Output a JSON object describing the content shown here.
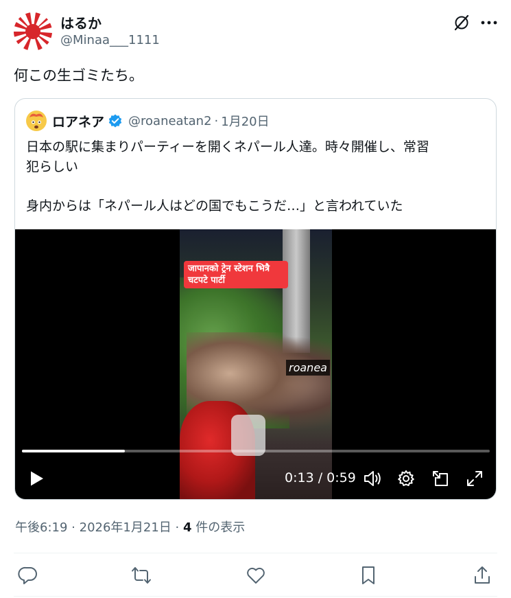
{
  "author": {
    "name": "はるか",
    "handle": "@Minaa___1111",
    "avatar_icon": "rising-sun-flag-avatar"
  },
  "tweet": {
    "text": "何この生ゴミたち。"
  },
  "quote": {
    "avatar_icon": "exploding-head-emoji",
    "name": "ロアネア",
    "verified": true,
    "handle": "@roaneatan2",
    "separator": "·",
    "date": "1月20日",
    "lines": [
      "日本の駅に集まりパーティーを開くネパール人達。時々開催し、常習",
      "犯らしい",
      "身内からは「ネパール人はどの国でもこうだ…」と言われていた"
    ],
    "video": {
      "overlay_caption": "जापानको ट्रेन स्टेशन भित्रै चटपटे पार्टी",
      "watermark": "roanea",
      "time": "0:13 / 0:59",
      "progress": 0.22,
      "controls": [
        "play-icon",
        "volume-icon",
        "settings-icon",
        "popout-icon",
        "fullscreen-icon"
      ]
    }
  },
  "meta": {
    "time": "午後6:19",
    "date": "2026年1月21日",
    "separator": "·",
    "views_count": "4",
    "views_label": " 件の表示"
  },
  "actions": [
    "reply-icon",
    "retweet-icon",
    "like-icon",
    "bookmark-icon",
    "share-icon"
  ],
  "colors": {
    "text": "#0f1419",
    "secondary": "#536471",
    "verified": "#1d9bf0",
    "border": "#cfd9de",
    "caption_bg": "#f0383c"
  }
}
